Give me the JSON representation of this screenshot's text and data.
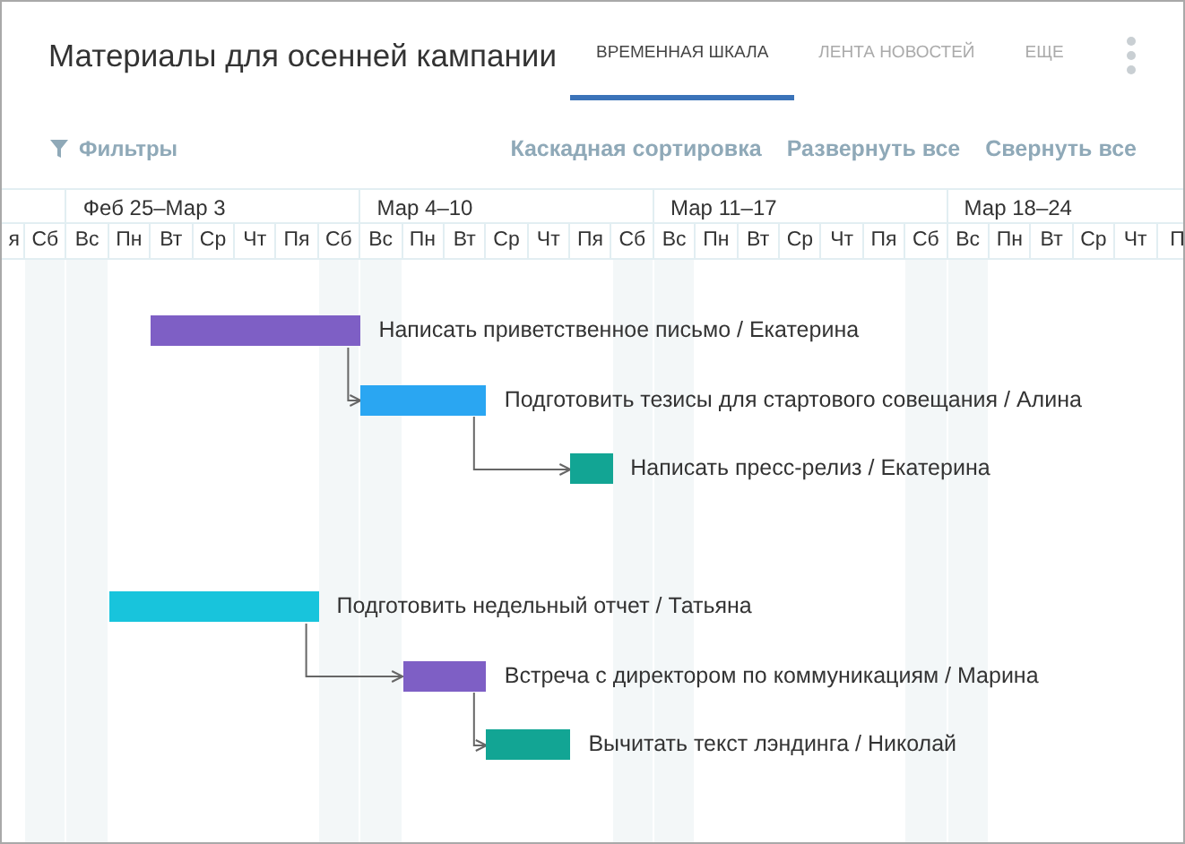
{
  "title": "Материалы для осенней кампании",
  "tabs": [
    {
      "label": "ВРЕМЕННАЯ ШКАЛА",
      "selected": true
    },
    {
      "label": "ЛЕНТА НОВОСТЕЙ",
      "selected": false
    },
    {
      "label": "ЕЩЕ",
      "selected": false
    }
  ],
  "toolbar": {
    "filters": "Фильтры",
    "actions": [
      "Каскадная сортировка",
      "Развернуть все",
      "Свернуть все"
    ]
  },
  "weeks": [
    "Феб 25–Мар 3",
    "Мар 4–10",
    "Мар 11–17",
    "Мар 18–24"
  ],
  "days": [
    "я",
    "Сб",
    "Вс",
    "Пн",
    "Вт",
    "Ср",
    "Чт",
    "Пя",
    "Сб",
    "Вс",
    "Пн",
    "Вт",
    "Ср",
    "Чт",
    "Пя",
    "Сб",
    "Вс",
    "Пн",
    "Вт",
    "Ср",
    "Чт",
    "Пя",
    "Сб",
    "Вс",
    "Пн",
    "Вт",
    "Ср",
    "Чт",
    "П"
  ],
  "tasks": [
    {
      "label": "Написать приветственное письмо / Екатерина",
      "color": "#7e5fc5"
    },
    {
      "label": "Подготовить тезисы для стартового совещания / Алина",
      "color": "#2aa6f2"
    },
    {
      "label": "Написать пресс-релиз / Екатерина",
      "color": "#12a594"
    },
    {
      "label": "Подготовить недельный отчет / Татьяна",
      "color": "#18c4dc"
    },
    {
      "label": "Встреча с директором по коммуникациям / Марина",
      "color": "#7e5fc5"
    },
    {
      "label": "Вычитать текст лэндинга / Николай",
      "color": "#12a594"
    }
  ]
}
